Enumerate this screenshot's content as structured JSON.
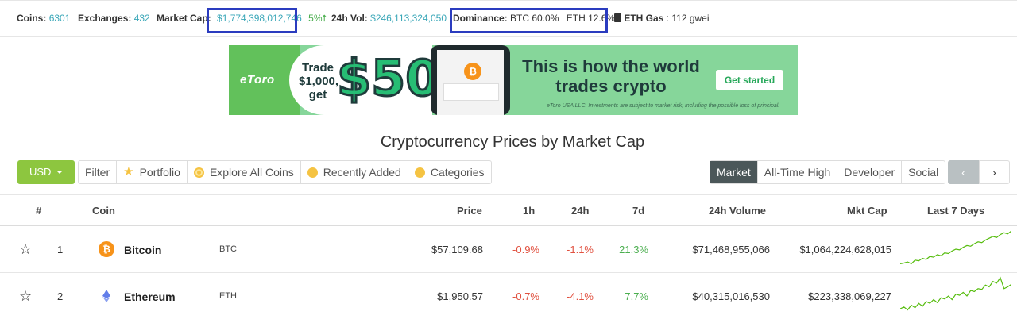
{
  "stats": {
    "coins_label": "Coins:",
    "coins_value": "6301",
    "exchanges_label": "Exchanges:",
    "exchanges_value": "432",
    "marketcap_label": "Market Cap:",
    "marketcap_value": "$1,774,398,012,746",
    "marketcap_change": "5%",
    "vol_label": "24h Vol:",
    "vol_value": "$246,113,324,050",
    "dominance_label": "Dominance:",
    "dominance_btc": "BTC 60.0%",
    "dominance_eth": "ETH 12.6%",
    "gas_label": "ETH Gas",
    "gas_value": ": 112 gwei"
  },
  "banner": {
    "brand": "eToro",
    "trade_text": "Trade $1,000, get",
    "amount": "$50",
    "headline": "This is how the world trades crypto",
    "cta": "Get started",
    "disclaimer": "eToro USA LLC. Investments are subject to market risk, including the possible loss of principal."
  },
  "page": {
    "title": "Cryptocurrency Prices by Market Cap"
  },
  "toolbar": {
    "currency": "USD",
    "filters": [
      "Filter",
      "Portfolio",
      "Explore All Coins",
      "Recently Added",
      "Categories"
    ],
    "views": [
      "Market",
      "All-Time High",
      "Developer",
      "Social"
    ],
    "active_view": "Market",
    "prev": "‹",
    "next": "›"
  },
  "table": {
    "headers": [
      "#",
      "Coin",
      "Price",
      "1h",
      "24h",
      "7d",
      "24h Volume",
      "Mkt Cap",
      "Last 7 Days"
    ],
    "rows": [
      {
        "rank": "1",
        "name": "Bitcoin",
        "symbol": "BTC",
        "price": "$57,109.68",
        "h1": "-0.9%",
        "h24": "-1.1%",
        "d7": "21.3%",
        "volume": "$71,468,955,066",
        "mktcap": "$1,064,224,628,015",
        "icon_color": "#f7931a",
        "spark": [
          0.1,
          0.12,
          0.15,
          0.1,
          0.2,
          0.18,
          0.25,
          0.22,
          0.3,
          0.28,
          0.35,
          0.32,
          0.4,
          0.38,
          0.45,
          0.5,
          0.48,
          0.55,
          0.6,
          0.58,
          0.65,
          0.7,
          0.68,
          0.75,
          0.8,
          0.85,
          0.82,
          0.9,
          0.95,
          0.92,
          1.0
        ]
      },
      {
        "rank": "2",
        "name": "Ethereum",
        "symbol": "ETH",
        "price": "$1,950.57",
        "h1": "-0.7%",
        "h24": "-4.1%",
        "d7": "7.7%",
        "volume": "$40,315,016,530",
        "mktcap": "$223,338,069,227",
        "icon_color": "#627eea",
        "spark": [
          0.15,
          0.2,
          0.12,
          0.25,
          0.18,
          0.3,
          0.22,
          0.35,
          0.3,
          0.4,
          0.32,
          0.45,
          0.42,
          0.5,
          0.4,
          0.55,
          0.52,
          0.6,
          0.5,
          0.65,
          0.62,
          0.7,
          0.68,
          0.8,
          0.75,
          0.9,
          0.85,
          1.0,
          0.7,
          0.75,
          0.82
        ]
      }
    ]
  },
  "colors": {
    "accent": "#8dc63f",
    "teal": "#3aa7b8",
    "negative": "#e15241",
    "positive": "#4caf50",
    "highlight": "#2b3cbf"
  }
}
